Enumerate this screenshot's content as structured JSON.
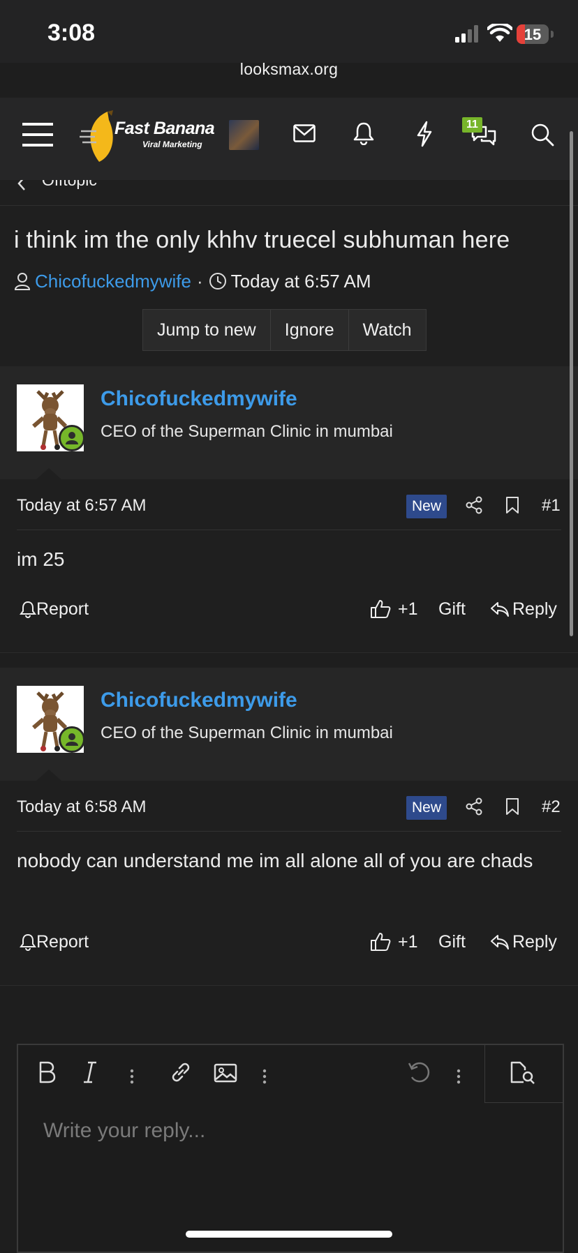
{
  "status_bar": {
    "time": "3:08",
    "battery_level": "15",
    "battery_fraction": 0.15
  },
  "browser": {
    "url": "looksmax.org"
  },
  "header": {
    "logo_line1": "Fast Banana",
    "logo_line2": "Viral Marketing",
    "notification_badge": "11",
    "icons": [
      "menu-icon",
      "mail-icon",
      "bell-icon",
      "lightning-icon",
      "conversations-icon",
      "search-icon"
    ]
  },
  "breadcrumb": {
    "label": "Offtopic"
  },
  "thread": {
    "title": "i think im the only khhv truecel subhuman here",
    "author": "Chicofuckedmywife",
    "separator": "·",
    "date": "Today at 6:57 AM",
    "buttons": {
      "jump": "Jump to new",
      "ignore": "Ignore",
      "watch": "Watch"
    }
  },
  "posts": [
    {
      "username": "Chicofuckedmywife",
      "user_title": "CEO of the Superman Clinic in mumbai",
      "date": "Today at 6:57 AM",
      "badge": "New",
      "number": "#1",
      "message": "im 25",
      "report": "Report",
      "like": "+1",
      "gift": "Gift",
      "reply": "Reply"
    },
    {
      "username": "Chicofuckedmywife",
      "user_title": "CEO of the Superman Clinic in mumbai",
      "date": "Today at 6:58 AM",
      "badge": "New",
      "number": "#2",
      "message": "nobody can understand me im all alone all of you are chads",
      "report": "Report",
      "like": "+1",
      "gift": "Gift",
      "reply": "Reply"
    }
  ],
  "editor": {
    "placeholder": "Write your reply..."
  },
  "colors": {
    "link": "#3d9be9",
    "online": "#76b72a",
    "new_badge": "#2e4a8c",
    "background": "#1e1e1e"
  }
}
